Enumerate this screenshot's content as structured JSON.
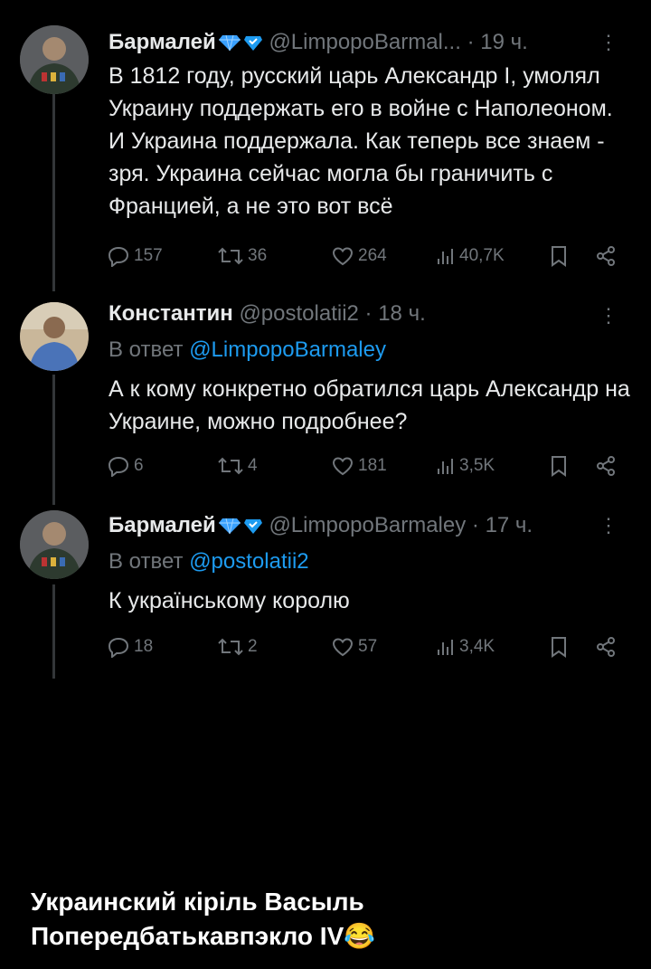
{
  "tweets": [
    {
      "name": "Бармалей",
      "handle": "@LimpopoBarmal...",
      "time": "· 19 ч.",
      "replying_label": "",
      "replying_to": "",
      "body": "В 1812 году, русский царь Александр I, умолял Украину поддержать его в войне с Наполеоном. И Украина поддержала. Как теперь все знаем - зря. Украина сейчас могла бы граничить с Францией, а не это вот всё",
      "replies": "157",
      "retweets": "36",
      "likes": "264",
      "views": "40,7K"
    },
    {
      "name": "Константин",
      "handle": "@postolatii2",
      "time": "· 18 ч.",
      "replying_label": "В ответ",
      "replying_to": "@LimpopoBarmaley",
      "body": "А к кому конкретно обратился царь Александр на Украине, можно подробнее?",
      "replies": "6",
      "retweets": "4",
      "likes": "181",
      "views": "3,5K"
    },
    {
      "name": "Бармалей",
      "handle": "@LimpopoBarmaley",
      "time": "· 17 ч.",
      "replying_label": "В ответ",
      "replying_to": "@postolatii2",
      "body": "К українському королю",
      "replies": "18",
      "retweets": "2",
      "likes": "57",
      "views": "3,4K"
    }
  ],
  "caption": {
    "line1": "Украинский кіріль Васыль",
    "line2": "Попередбатькавпэкло IV",
    "emoji": "😂"
  },
  "icons": {
    "more": "more-icon",
    "reply": "reply-icon",
    "retweet": "retweet-icon",
    "like": "heart-icon",
    "views": "views-icon",
    "bookmark": "bookmark-icon",
    "share": "share-icon"
  },
  "colors": {
    "background": "#000000",
    "text": "#e7e9ea",
    "muted": "#71767b",
    "link": "#1d9bf0",
    "badge": "#1d9bf0"
  }
}
